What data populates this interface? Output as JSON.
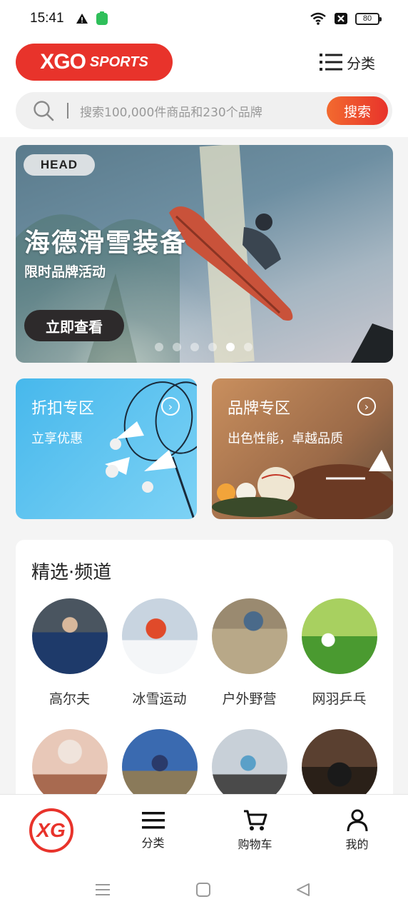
{
  "status": {
    "time": "15:41",
    "battery": "80"
  },
  "header": {
    "logo_main": "XGO",
    "logo_sub": "SPORTS",
    "menu_label": "分类"
  },
  "search": {
    "placeholder": "搜索100,000件商品和230个品牌",
    "button_label": "搜索"
  },
  "banner": {
    "brand": "HEAD",
    "title": "海德滑雪装备",
    "subtitle": "限时品牌活动",
    "cta": "立即查看",
    "slide_count": 6,
    "active_slide": 5
  },
  "promos": [
    {
      "title": "折扣专区",
      "subtitle": "立享优惠"
    },
    {
      "title": "品牌专区",
      "subtitle": "出色性能，卓越品质"
    }
  ],
  "channels": {
    "title": "精选·频道",
    "items": [
      {
        "label": "高尔夫"
      },
      {
        "label": "冰雪运动"
      },
      {
        "label": "户外野营"
      },
      {
        "label": "网羽乒乓"
      },
      {
        "label": ""
      },
      {
        "label": ""
      },
      {
        "label": ""
      },
      {
        "label": ""
      }
    ]
  },
  "tabbar": {
    "home_logo": "XG",
    "tabs": [
      {
        "label": "分类"
      },
      {
        "label": "购物车"
      },
      {
        "label": "我的"
      }
    ]
  },
  "colors": {
    "brand_red": "#e8332b",
    "search_gradient_start": "#f26a2f"
  }
}
